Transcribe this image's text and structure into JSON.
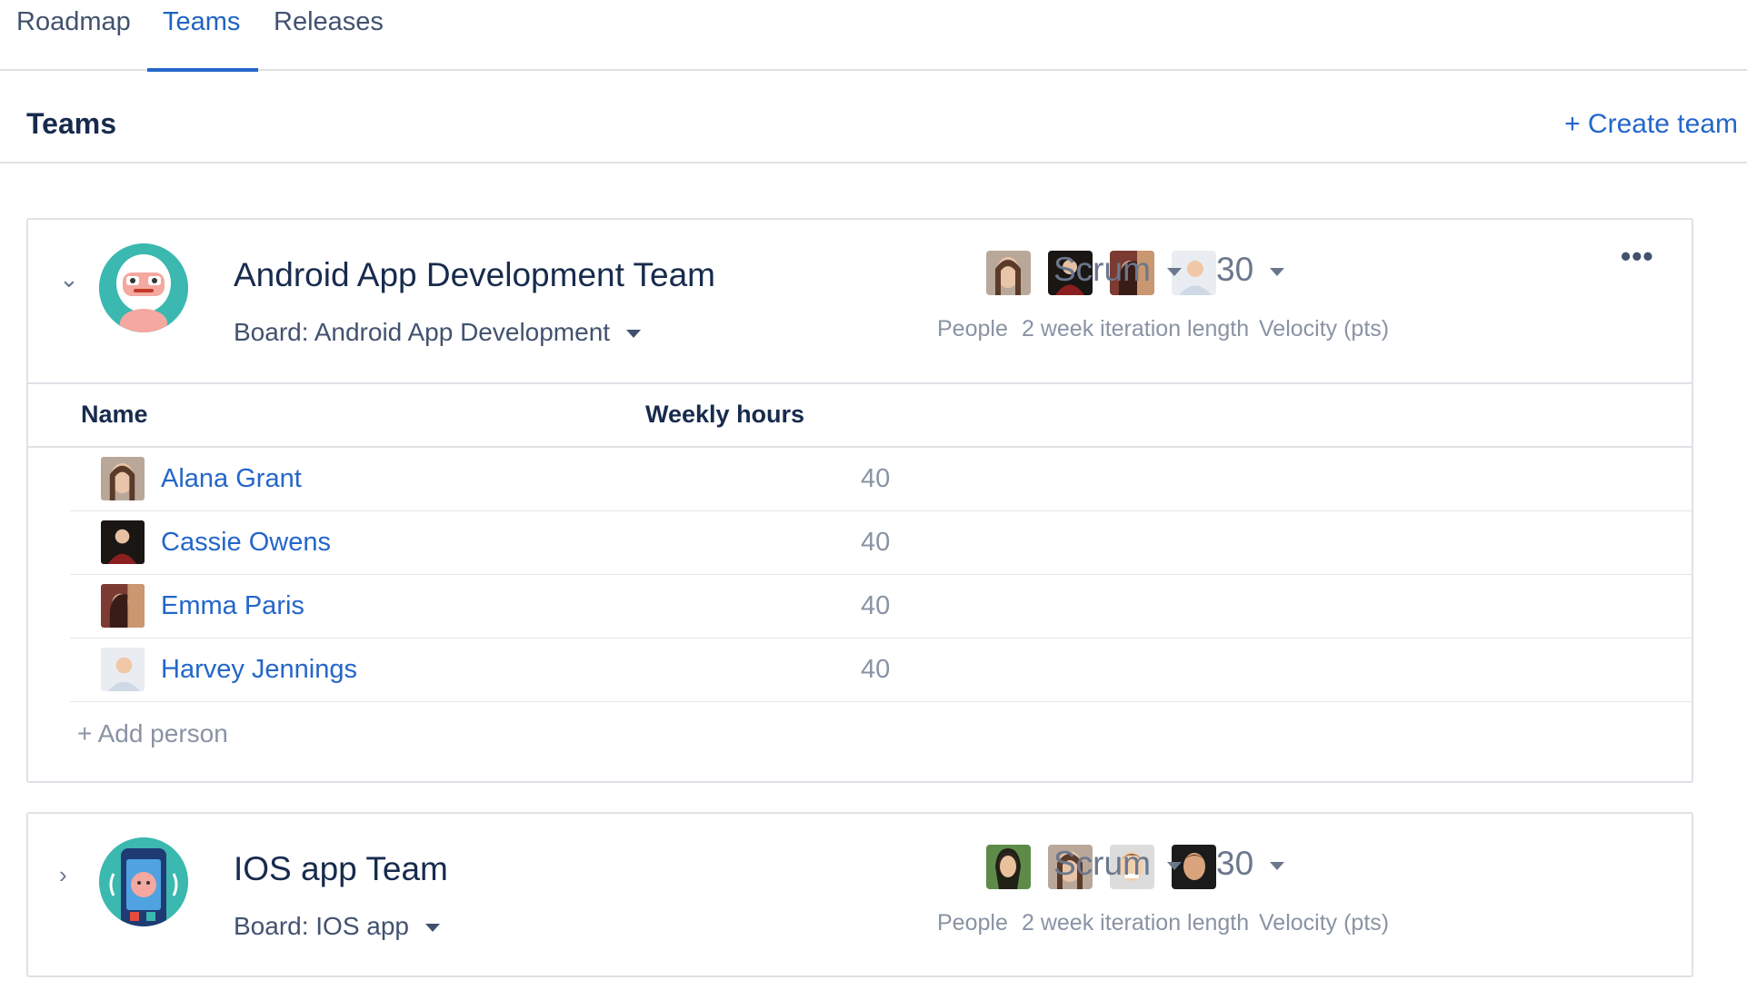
{
  "nav": {
    "tabs": [
      {
        "label": "Roadmap"
      },
      {
        "label": "Teams"
      },
      {
        "label": "Releases"
      }
    ]
  },
  "header": {
    "title": "Teams",
    "create_team": "+ Create team"
  },
  "teams": [
    {
      "name": "Android App Development Team",
      "board": "Board: Android App Development",
      "methodology": "Scrum",
      "velocity": "30",
      "people_label": "People",
      "iteration_label": "2 week iteration length",
      "velocity_label": "Velocity (pts)",
      "table": {
        "col_name": "Name",
        "col_hours": "Weekly hours",
        "rows": [
          {
            "name": "Alana Grant",
            "hours": "40"
          },
          {
            "name": "Cassie Owens",
            "hours": "40"
          },
          {
            "name": "Emma Paris",
            "hours": "40"
          },
          {
            "name": "Harvey Jennings",
            "hours": "40"
          }
        ],
        "add_person": "+ Add person"
      }
    },
    {
      "name": "IOS app Team",
      "board": "Board: IOS app",
      "methodology": "Scrum",
      "velocity": "30",
      "people_label": "People",
      "iteration_label": "2 week iteration length",
      "velocity_label": "Velocity (pts)"
    }
  ],
  "colors": {
    "accent": "#2466c9",
    "border": "#dfe1e6",
    "muted_text": "#8993a4",
    "team_avatar_bg": "#3bb8b0"
  },
  "icons": {
    "expanded": "chevron-down-icon",
    "collapsed": "chevron-right-icon",
    "more": "more-dots-icon",
    "dropdown": "caret-down-icon"
  }
}
